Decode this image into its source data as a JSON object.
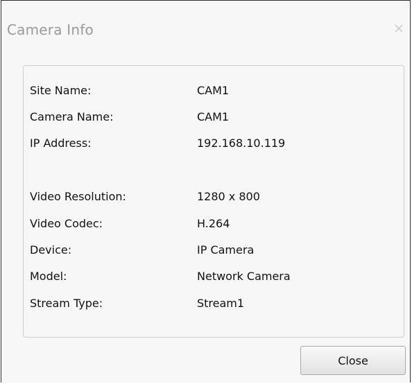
{
  "window": {
    "title": "Camera Info",
    "close_icon": "close-icon"
  },
  "info": {
    "site_name_label": "Site Name:",
    "site_name_value": "CAM1",
    "camera_name_label": "Camera Name:",
    "camera_name_value": "CAM1",
    "ip_address_label": "IP Address:",
    "ip_address_value": "192.168.10.119",
    "video_resolution_label": "Video Resolution:",
    "video_resolution_value": "1280 x 800",
    "video_codec_label": "Video Codec:",
    "video_codec_value": "H.264",
    "device_label": "Device:",
    "device_value": "IP Camera",
    "model_label": "Model:",
    "model_value": "Network Camera",
    "stream_type_label": "Stream Type:",
    "stream_type_value": "Stream1"
  },
  "buttons": {
    "close_label": "Close"
  },
  "colors": {
    "title_text": "#9a9a9a",
    "panel_border": "#cfcfcf",
    "background": "#f7f7f7"
  }
}
